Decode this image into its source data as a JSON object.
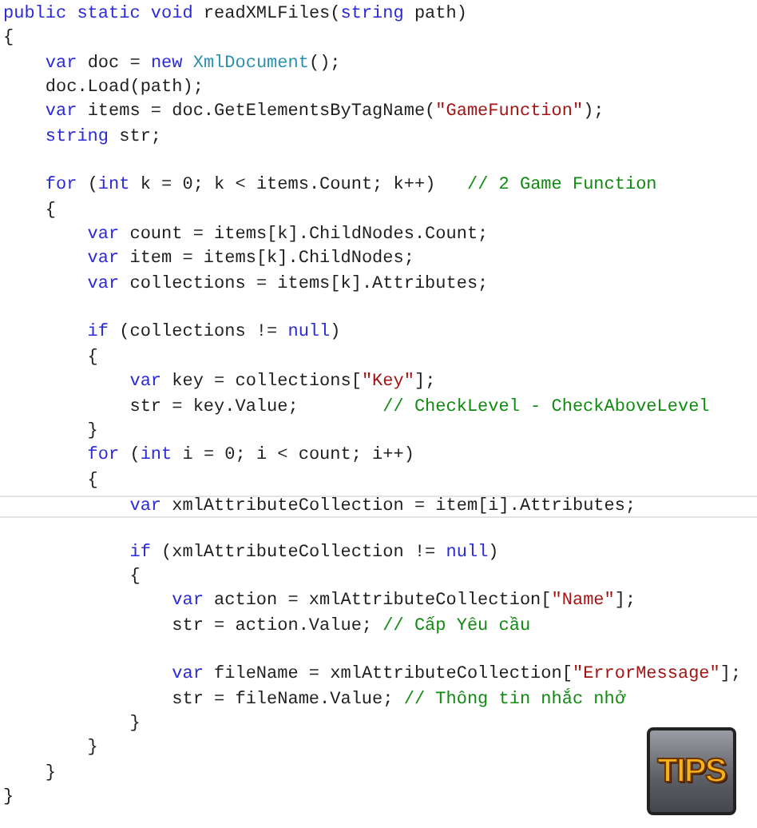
{
  "editor": {
    "lines": [
      {
        "current": false,
        "gap_before": false,
        "tokens": [
          {
            "kind": "keyword",
            "text": "public static void"
          },
          {
            "kind": "plain",
            "text": " readXMLFiles("
          },
          {
            "kind": "keyword",
            "text": "string"
          },
          {
            "kind": "plain",
            "text": " path)"
          }
        ]
      },
      {
        "current": false,
        "gap_before": false,
        "tokens": [
          {
            "kind": "plain",
            "text": "{"
          }
        ]
      },
      {
        "current": false,
        "gap_before": false,
        "tokens": [
          {
            "kind": "keyword",
            "text": "    var"
          },
          {
            "kind": "plain",
            "text": " doc = "
          },
          {
            "kind": "keyword",
            "text": "new "
          },
          {
            "kind": "type",
            "text": "XmlDocument"
          },
          {
            "kind": "plain",
            "text": "();"
          }
        ]
      },
      {
        "current": false,
        "gap_before": false,
        "tokens": [
          {
            "kind": "plain",
            "text": "    doc.Load(path);"
          }
        ]
      },
      {
        "current": false,
        "gap_before": false,
        "tokens": [
          {
            "kind": "keyword",
            "text": "    var"
          },
          {
            "kind": "plain",
            "text": " items = doc.GetElementsByTagName("
          },
          {
            "kind": "string",
            "text": "\"GameFunction\""
          },
          {
            "kind": "plain",
            "text": ");"
          }
        ]
      },
      {
        "current": false,
        "gap_before": false,
        "tokens": [
          {
            "kind": "keyword",
            "text": "    string"
          },
          {
            "kind": "plain",
            "text": " str;"
          }
        ]
      },
      {
        "current": false,
        "gap_before": true,
        "tokens": [
          {
            "kind": "keyword",
            "text": "    for"
          },
          {
            "kind": "plain",
            "text": " ("
          },
          {
            "kind": "keyword",
            "text": "int"
          },
          {
            "kind": "plain",
            "text": " k = 0; k < items.Count; k++)   "
          },
          {
            "kind": "comment",
            "text": "// 2 Game Function"
          }
        ]
      },
      {
        "current": false,
        "gap_before": false,
        "tokens": [
          {
            "kind": "plain",
            "text": "    {"
          }
        ]
      },
      {
        "current": false,
        "gap_before": false,
        "tokens": [
          {
            "kind": "keyword",
            "text": "        var"
          },
          {
            "kind": "plain",
            "text": " count = items[k].ChildNodes.Count;"
          }
        ]
      },
      {
        "current": false,
        "gap_before": false,
        "tokens": [
          {
            "kind": "keyword",
            "text": "        var"
          },
          {
            "kind": "plain",
            "text": " item = items[k].ChildNodes;"
          }
        ]
      },
      {
        "current": false,
        "gap_before": false,
        "tokens": [
          {
            "kind": "keyword",
            "text": "        var"
          },
          {
            "kind": "plain",
            "text": " collections = items[k].Attributes;"
          }
        ]
      },
      {
        "current": false,
        "gap_before": true,
        "tokens": [
          {
            "kind": "keyword",
            "text": "        if"
          },
          {
            "kind": "plain",
            "text": " (collections != "
          },
          {
            "kind": "keyword",
            "text": "null"
          },
          {
            "kind": "plain",
            "text": ")"
          }
        ]
      },
      {
        "current": false,
        "gap_before": false,
        "tokens": [
          {
            "kind": "plain",
            "text": "        {"
          }
        ]
      },
      {
        "current": false,
        "gap_before": false,
        "tokens": [
          {
            "kind": "keyword",
            "text": "            var"
          },
          {
            "kind": "plain",
            "text": " key = collections["
          },
          {
            "kind": "string",
            "text": "\"Key\""
          },
          {
            "kind": "plain",
            "text": "];"
          }
        ]
      },
      {
        "current": false,
        "gap_before": false,
        "tokens": [
          {
            "kind": "plain",
            "text": "            str = key.Value;        "
          },
          {
            "kind": "comment",
            "text": "// CheckLevel - CheckAboveLevel"
          }
        ]
      },
      {
        "current": false,
        "gap_before": false,
        "tokens": [
          {
            "kind": "plain",
            "text": "        }"
          }
        ]
      },
      {
        "current": false,
        "gap_before": false,
        "tokens": [
          {
            "kind": "keyword",
            "text": "        for"
          },
          {
            "kind": "plain",
            "text": " ("
          },
          {
            "kind": "keyword",
            "text": "int"
          },
          {
            "kind": "plain",
            "text": " i = 0; i < count; i++)"
          }
        ]
      },
      {
        "current": false,
        "gap_before": false,
        "tokens": [
          {
            "kind": "plain",
            "text": "        {"
          }
        ]
      },
      {
        "current": true,
        "gap_before": false,
        "tokens": [
          {
            "kind": "keyword",
            "text": "            var"
          },
          {
            "kind": "plain",
            "text": " xmlAttributeCollection = item[i].Attributes;"
          }
        ]
      },
      {
        "current": false,
        "gap_before": true,
        "tokens": [
          {
            "kind": "keyword",
            "text": "            if"
          },
          {
            "kind": "plain",
            "text": " (xmlAttributeCollection != "
          },
          {
            "kind": "keyword",
            "text": "null"
          },
          {
            "kind": "plain",
            "text": ")"
          }
        ]
      },
      {
        "current": false,
        "gap_before": false,
        "tokens": [
          {
            "kind": "plain",
            "text": "            {"
          }
        ]
      },
      {
        "current": false,
        "gap_before": false,
        "tokens": [
          {
            "kind": "keyword",
            "text": "                var"
          },
          {
            "kind": "plain",
            "text": " action = xmlAttributeCollection["
          },
          {
            "kind": "string",
            "text": "\"Name\""
          },
          {
            "kind": "plain",
            "text": "];"
          }
        ]
      },
      {
        "current": false,
        "gap_before": false,
        "tokens": [
          {
            "kind": "plain",
            "text": "                str = action.Value; "
          },
          {
            "kind": "comment",
            "text": "// Cấp Yêu cầu"
          }
        ]
      },
      {
        "current": false,
        "gap_before": true,
        "tokens": [
          {
            "kind": "keyword",
            "text": "                var"
          },
          {
            "kind": "plain",
            "text": " fileName = xmlAttributeCollection["
          },
          {
            "kind": "string",
            "text": "\"ErrorMessage\""
          },
          {
            "kind": "plain",
            "text": "];"
          }
        ]
      },
      {
        "current": false,
        "gap_before": false,
        "tokens": [
          {
            "kind": "plain",
            "text": "                str = fileName.Value; "
          },
          {
            "kind": "comment",
            "text": "// Thông tin nhắc nhở"
          }
        ]
      },
      {
        "current": false,
        "gap_before": false,
        "tokens": [
          {
            "kind": "plain",
            "text": "            }"
          }
        ]
      },
      {
        "current": false,
        "gap_before": false,
        "tokens": [
          {
            "kind": "plain",
            "text": "        }"
          }
        ]
      },
      {
        "current": false,
        "gap_before": false,
        "tokens": [
          {
            "kind": "plain",
            "text": "    }"
          }
        ]
      },
      {
        "current": false,
        "gap_before": false,
        "tokens": [
          {
            "kind": "plain",
            "text": "}"
          }
        ]
      }
    ]
  },
  "badge": {
    "label": "TIPS"
  }
}
